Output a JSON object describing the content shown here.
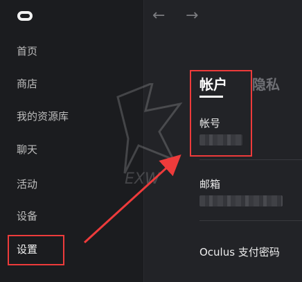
{
  "nav": {
    "items": [
      {
        "label": "首页"
      },
      {
        "label": "商店"
      },
      {
        "label": "我的资源库"
      },
      {
        "label": "聊天"
      },
      {
        "label": "活动"
      },
      {
        "label": "设备"
      },
      {
        "label": "设置"
      }
    ],
    "active_index": 6
  },
  "toolbar": {
    "back_icon": "arrow-left-icon",
    "forward_icon": "arrow-right-icon",
    "back_glyph": "←",
    "forward_glyph": "→"
  },
  "tabs": [
    {
      "label": "帐户",
      "selected": true
    },
    {
      "label": "隐私",
      "selected": false
    }
  ],
  "fields": {
    "account_label": "帐号",
    "email_label": "邮箱",
    "payment_pin_label": "Oculus 支付密码"
  },
  "annotation": {
    "watermark_text": "EXW",
    "highlight_color": "#ee3b3b"
  },
  "colors": {
    "sidebar_bg": "#1b1c1f",
    "main_bg": "#222327",
    "annotation_red": "#ee3b3b"
  }
}
